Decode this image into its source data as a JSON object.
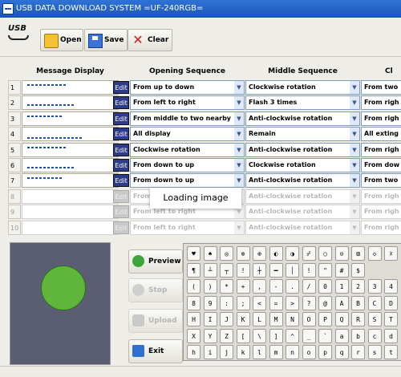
{
  "window": {
    "title": "USB DATA DOWNLOAD SYSTEM =UF-240RGB="
  },
  "logo": {
    "text": "USB"
  },
  "toolbar": {
    "open_label": "Open",
    "save_label": "Save",
    "clear_label": "Clear"
  },
  "columns": {
    "message": "Message Display",
    "opening": "Opening Sequence",
    "middle": "Middle Sequence",
    "closing": "Cl"
  },
  "edit_label": "Edit",
  "rows": [
    {
      "num": "1",
      "opening": "From up to down",
      "middle": "Clockwise rotation",
      "closing": "From two"
    },
    {
      "num": "2",
      "opening": "From left to right",
      "middle": "Flash 3 times",
      "closing": "From righ"
    },
    {
      "num": "3",
      "opening": "From middle to two nearby",
      "middle": "Anti-clockwise rotation",
      "closing": "From righ"
    },
    {
      "num": "4",
      "opening": "All display",
      "middle": "Remain",
      "closing": "All exting"
    },
    {
      "num": "5",
      "opening": "Clockwise rotation",
      "middle": "Anti-clockwise rotation",
      "closing": "From righ"
    },
    {
      "num": "6",
      "opening": "From down to up",
      "middle": "Clockwise rotation",
      "closing": "From dow"
    },
    {
      "num": "7",
      "opening": "From down to up",
      "middle": "Anti-clockwise rotation",
      "closing": "From two"
    },
    {
      "num": "8",
      "opening": "From",
      "middle": "Anti-clockwise rotation",
      "closing": "From righ"
    },
    {
      "num": "9",
      "opening": "From left to right",
      "middle": "Anti-clockwise rotation",
      "closing": "From righ"
    },
    {
      "num": "10",
      "opening": "From left to right",
      "middle": "Anti-clockwise rotation",
      "closing": "From righ"
    }
  ],
  "loading_text": "Loading image",
  "side_buttons": {
    "preview": "Preview",
    "stop": "Stop",
    "upload": "Upload",
    "exit": "Exit"
  },
  "keyboard": {
    "rows": [
      [
        "♥",
        "♠",
        "◎",
        "⊗",
        "⊕",
        "◐",
        "◑",
        "☍",
        "○",
        "⊙",
        "⊠",
        "◇",
        "☓"
      ],
      [
        "¶",
        "┴",
        "┬",
        "!",
        "┼",
        "━",
        "│",
        "!",
        "\"",
        "#",
        "$"
      ],
      [
        "(",
        ")",
        "*",
        "+",
        ",",
        "-",
        ".",
        "/",
        "0",
        "1",
        "2",
        "3",
        "4"
      ],
      [
        "8",
        "9",
        ":",
        ";",
        "<",
        "=",
        ">",
        "?",
        "@",
        "A",
        "B",
        "C",
        "D"
      ],
      [
        "H",
        "I",
        "J",
        "K",
        "L",
        "M",
        "N",
        "O",
        "P",
        "Q",
        "R",
        "S",
        "T"
      ],
      [
        "X",
        "Y",
        "Z",
        "[",
        "\\",
        "]",
        "^",
        "_",
        "`",
        "a",
        "b",
        "c",
        "d"
      ],
      [
        "h",
        "i",
        "j",
        "k",
        "l",
        "m",
        "n",
        "o",
        "p",
        "q",
        "r",
        "s",
        "t"
      ]
    ]
  },
  "colors": {
    "titlebar": "#1a55b8",
    "preview_bg": "#5b5e73",
    "circle": "#5fb63a",
    "edit_button": "#2e3a8a"
  }
}
